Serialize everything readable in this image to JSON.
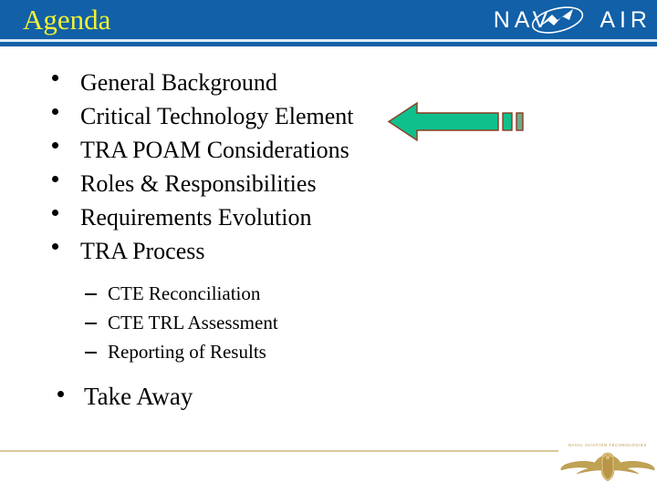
{
  "header": {
    "title": "Agenda",
    "title_color": "#F2F232",
    "banner_color": "#1160A8",
    "logo": {
      "text_left": "NAV",
      "text_right": "AIR",
      "icon": "navair-swoosh-icon",
      "color": "#FFFFFF"
    }
  },
  "content": {
    "bullets": [
      {
        "level": 1,
        "text": "General Background"
      },
      {
        "level": 1,
        "text": "Critical Technology Element"
      },
      {
        "level": 1,
        "text": "TRA POAM Considerations"
      },
      {
        "level": 1,
        "text": "Roles & Responsibilities"
      },
      {
        "level": 1,
        "text": "Requirements Evolution"
      },
      {
        "level": 1,
        "text": "TRA Process"
      },
      {
        "level": 2,
        "text": "CTE Reconciliation"
      },
      {
        "level": 2,
        "text": "CTE TRL Assessment"
      },
      {
        "level": 2,
        "text": "Reporting of Results"
      },
      {
        "level": 1,
        "text": "Take Away"
      }
    ]
  },
  "annotation": {
    "arrow": {
      "icon": "left-arrow-icon",
      "direction": "left",
      "fill_color": "#0FC08D",
      "outline_color": "#8A3A1E",
      "tail_segment_color": "#6FA98C",
      "points_at": "Critical Technology Element"
    }
  },
  "footer": {
    "rule_color": "#D9C89A",
    "emblem_label": "NAVAL AVIATION TECHNOLOGIES",
    "emblem_icon": "naval-aviator-wings-icon",
    "emblem_color": "#B8943F"
  }
}
